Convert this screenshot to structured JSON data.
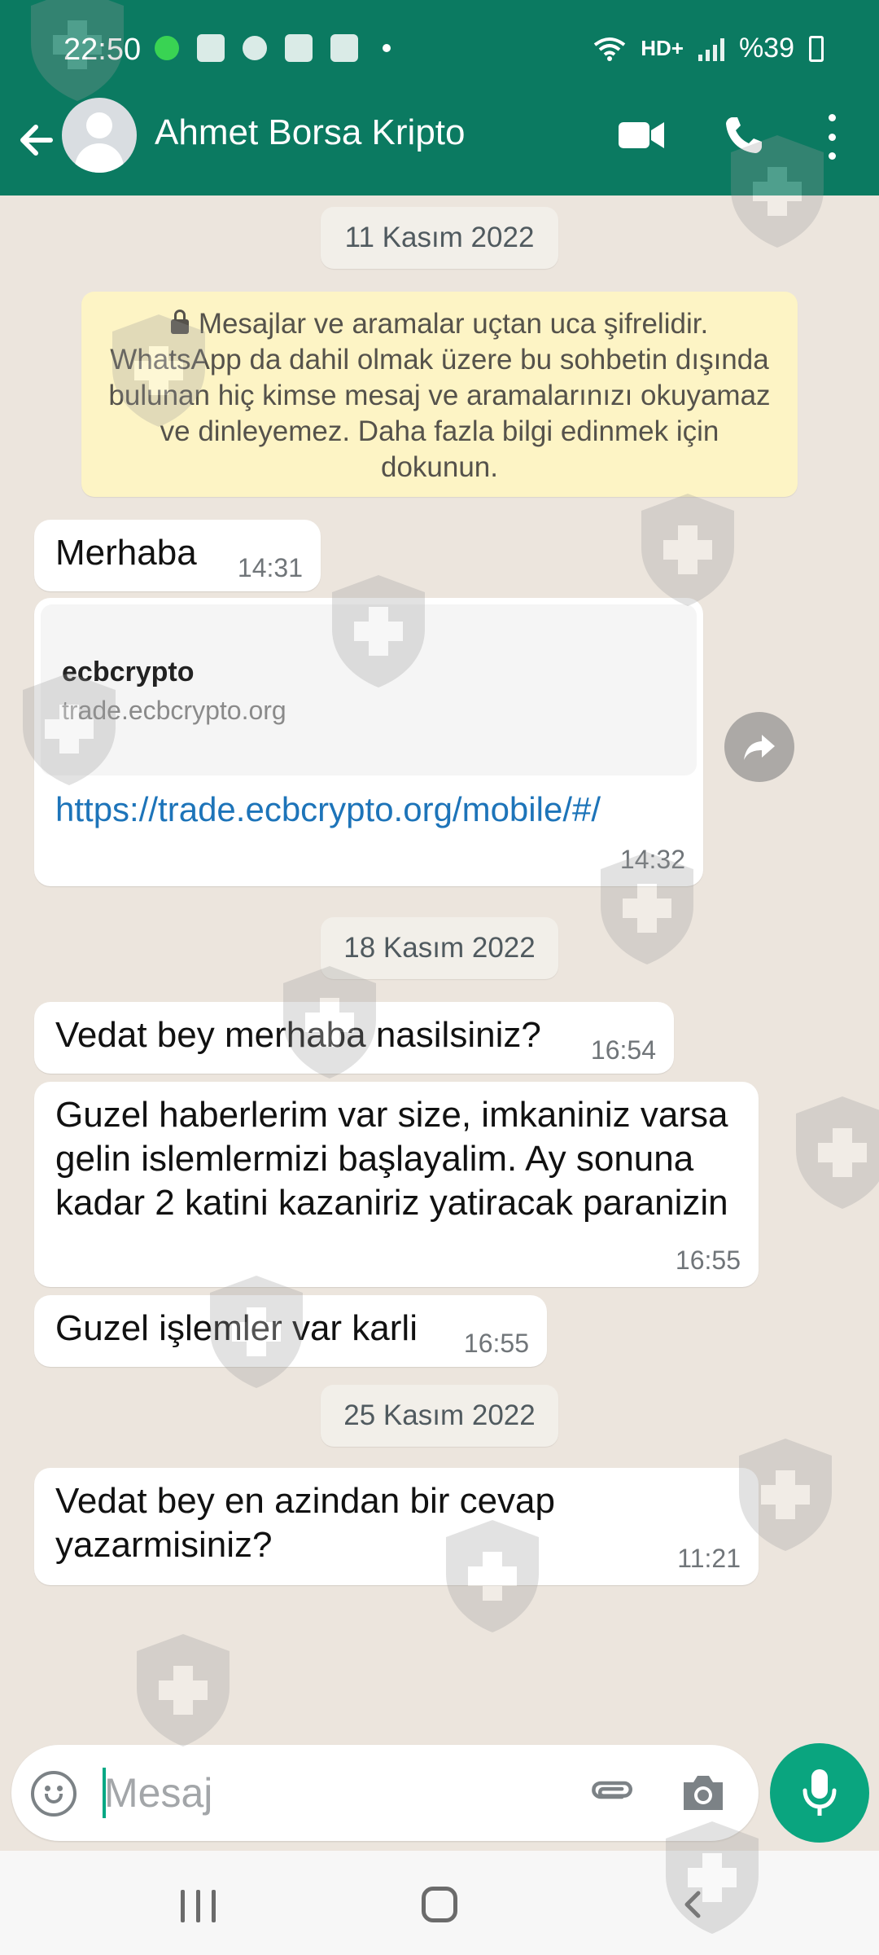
{
  "status_bar": {
    "time": "22:50",
    "network": "HD+",
    "battery": "%39"
  },
  "header": {
    "contact_name": "Ahmet Borsa Kripto"
  },
  "chat": {
    "dates": [
      "11 Kasım 2022",
      "18 Kasım 2022",
      "25 Kasım 2022"
    ],
    "system_message": "Mesajlar ve aramalar uçtan uca şifrelidir. WhatsApp da dahil olmak üzere bu sohbetin dışında bulunan hiç kimse mesaj ve aramalarınızı okuyamaz ve dinleyemez. Daha fazla bilgi edinmek için dokunun.",
    "messages": [
      {
        "text": "Merhaba",
        "time": "14:31"
      },
      {
        "link_title": "ecbcrypto",
        "link_domain": "trade.ecbcrypto.org",
        "text": "https://trade.ecbcrypto.org/mobile/#/",
        "time": "14:32"
      },
      {
        "text": "Vedat bey merhaba nasilsiniz?",
        "time": "16:54"
      },
      {
        "text": "Guzel haberlerim var size, imkaniniz varsa gelin islemlermizi başlayalim. Ay sonuna kadar 2 katini kazaniriz yatiracak paranizin",
        "time": "16:55"
      },
      {
        "text": "Guzel işlemler var karli",
        "time": "16:55"
      },
      {
        "text": "Vedat bey en azindan bir cevap yazarmisiniz?",
        "time": "11:21"
      }
    ]
  },
  "input": {
    "placeholder": "Mesaj"
  },
  "colors": {
    "header": "#0b7a61",
    "accent": "#0aa57f",
    "chat_bg": "#ece5dd",
    "link": "#1d74b9"
  },
  "icons": [
    "back-arrow-icon",
    "video-call-icon",
    "phone-icon",
    "more-vert-icon",
    "share-icon",
    "emoji-icon",
    "attach-icon",
    "camera-icon",
    "mic-icon"
  ]
}
